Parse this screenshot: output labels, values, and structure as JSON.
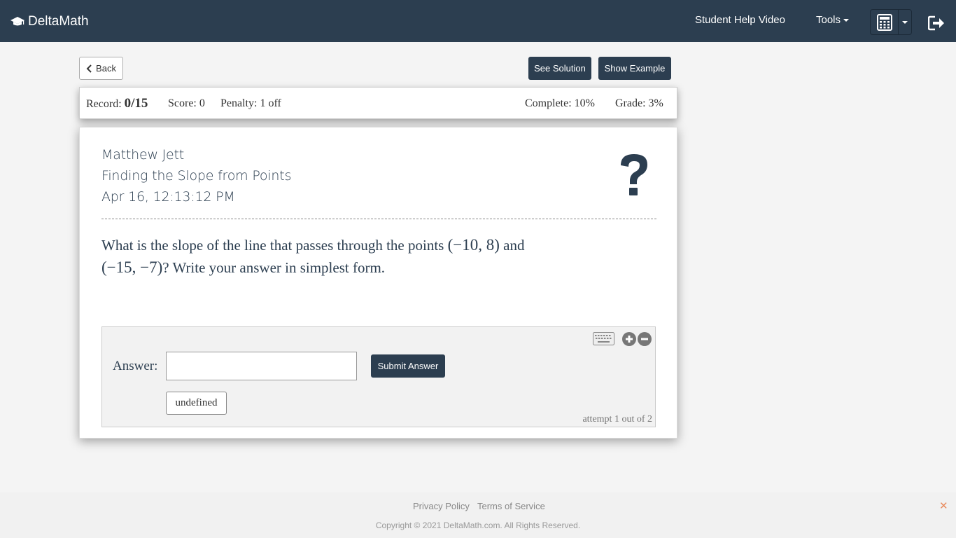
{
  "navbar": {
    "brand": "DeltaMath",
    "help_video": "Student Help Video",
    "tools": "Tools"
  },
  "toolbar": {
    "back": "Back",
    "see_solution": "See Solution",
    "show_example": "Show Example"
  },
  "status": {
    "record_label": "Record:",
    "record_value": "0/15",
    "score": "Score: 0",
    "penalty": "Penalty: 1 off",
    "complete": "Complete: 10%",
    "grade": "Grade: 3%"
  },
  "problem": {
    "student": "Matthew Jett",
    "topic": "Finding the Slope from Points",
    "timestamp": "Apr 16, 12:13:12 PM",
    "q_part1": "What is the slope of the line that passes through the points ",
    "point1": "(−10, 8)",
    "q_part2": " and",
    "point2": "(−15, −7)",
    "q_part3": "? Write your answer in simplest form."
  },
  "answer": {
    "label": "Answer:",
    "value": "",
    "submit": "Submit Answer",
    "undefined_btn": "undefined",
    "attempt": "attempt 1 out of 2"
  },
  "footer": {
    "privacy": "Privacy Policy",
    "terms": "Terms of Service",
    "copyright": "Copyright © 2021 DeltaMath.com. All Rights Reserved."
  },
  "colors": {
    "navbar": "#2c3e50",
    "accent": "#2c3e50",
    "close": "#e98c5f"
  },
  "icons": [
    "graduation-cap-icon",
    "calculator-icon",
    "logout-icon",
    "chevron-left-icon",
    "question-mark-icon",
    "keyboard-icon",
    "zoom-in-icon",
    "zoom-out-icon",
    "close-icon"
  ]
}
